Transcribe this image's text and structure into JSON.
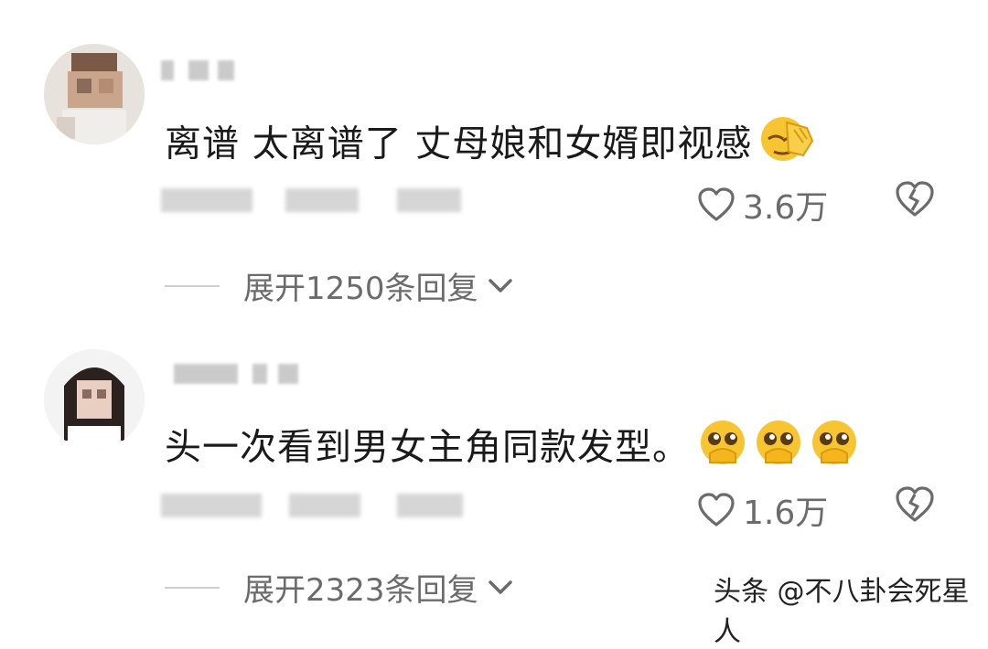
{
  "comments": [
    {
      "text": "离谱 太离谱了 丈母娘和女婿即视感",
      "emoji": "facepalm-emoji",
      "likes": "3.6万",
      "replies": "展开1250条回复"
    },
    {
      "text": "头一次看到男女主角同款发型。",
      "emoji": "pleading-hands-emoji",
      "likes": "1.6万",
      "replies": "展开2323条回复"
    }
  ],
  "watermark": "头条 @不八卦会死星人",
  "colors": {
    "text": "#1a1a1a",
    "muted": "#6b6b6b",
    "emoji": "#f7c531"
  }
}
